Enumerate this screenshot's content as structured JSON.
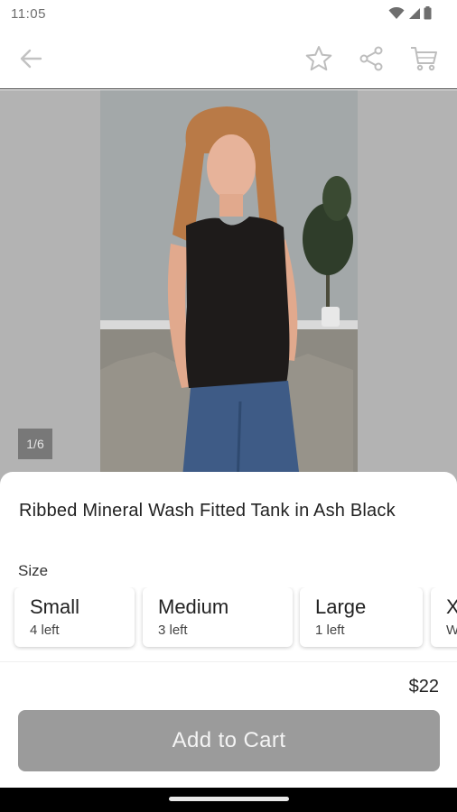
{
  "status_bar": {
    "time": "11:05",
    "icons": [
      "wifi-icon",
      "signal-icon",
      "battery-icon"
    ]
  },
  "app_bar": {
    "icons": [
      "back-arrow-icon",
      "star-icon",
      "share-icon",
      "cart-icon"
    ]
  },
  "gallery": {
    "page_indicator": "1/6"
  },
  "product": {
    "title": "Ribbed Mineral Wash Fitted Tank in Ash Black",
    "size_label": "Size",
    "sizes": [
      {
        "name": "Small",
        "stock": "4 left"
      },
      {
        "name": "Medium",
        "stock": "3 left"
      },
      {
        "name": "Large",
        "stock": "1 left"
      },
      {
        "name": "X",
        "stock": "W"
      }
    ],
    "price": "$22",
    "add_to_cart_label": "Add to Cart"
  },
  "colors": {
    "add_button_bg": "#9b9b9b",
    "icon_gray": "#bdbdbd"
  }
}
